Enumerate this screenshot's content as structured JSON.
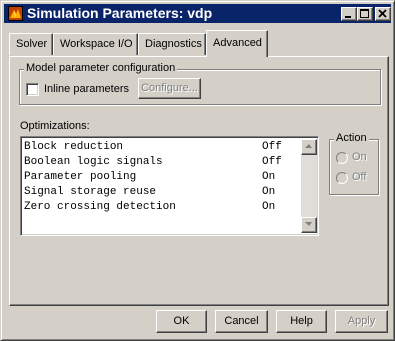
{
  "window": {
    "title": "Simulation Parameters: vdp",
    "icon": "matlab-logo-icon"
  },
  "tabs": [
    {
      "label": "Solver"
    },
    {
      "label": "Workspace I/O"
    },
    {
      "label": "Diagnostics"
    },
    {
      "label": "Advanced",
      "active": true
    }
  ],
  "model_param_group": {
    "title": "Model parameter configuration",
    "inline_label": "Inline parameters",
    "inline_checked": false,
    "configure_label": "Configure..."
  },
  "optimizations": {
    "label": "Optimizations:",
    "items": [
      {
        "name": "Block reduction",
        "value": "Off"
      },
      {
        "name": "Boolean logic signals",
        "value": "Off"
      },
      {
        "name": "Parameter pooling",
        "value": "On"
      },
      {
        "name": "Signal storage reuse",
        "value": "On"
      },
      {
        "name": "Zero crossing detection",
        "value": "On"
      }
    ]
  },
  "action_group": {
    "title": "Action",
    "on_label": "On",
    "off_label": "Off"
  },
  "footer": {
    "ok_label": "OK",
    "cancel_label": "Cancel",
    "help_label": "Help",
    "apply_label": "Apply"
  },
  "colors": {
    "titlebar": "#0a246a",
    "face": "#d4d0c8",
    "disabled_text": "#808080"
  }
}
